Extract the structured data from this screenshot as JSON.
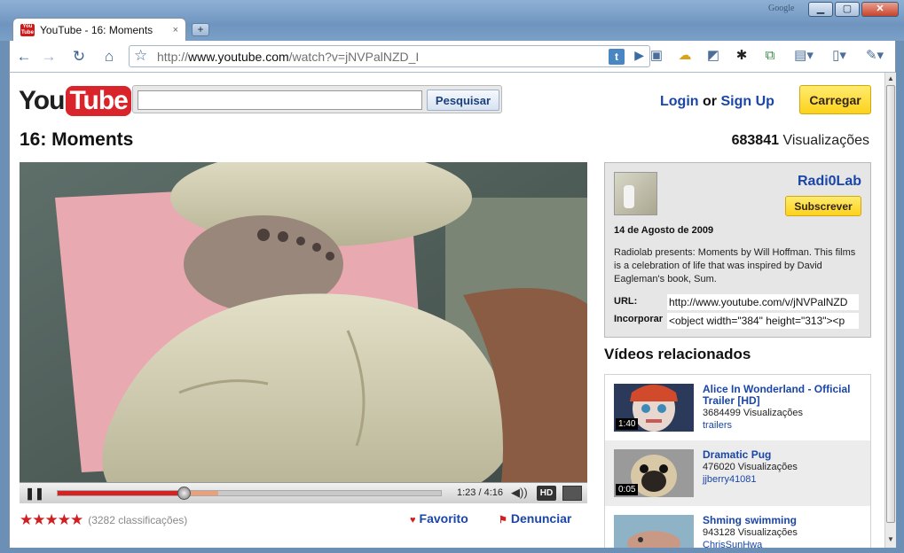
{
  "window": {
    "brand": "Google",
    "tab_title": "YouTube - 16: Moments",
    "tab_favicon": "You Tube",
    "tab_close": "×",
    "new_tab": "+",
    "minimize": "▁",
    "maximize": "▢",
    "close": "✕"
  },
  "toolbar": {
    "back": "←",
    "forward": "→",
    "reload": "↻",
    "home": "⌂",
    "star": "☆",
    "url_scheme": "http://",
    "url_host": "www.youtube.com",
    "url_path": "/watch?v=jNVPalNZD_I",
    "t_badge": "t",
    "go": "▶",
    "extensions": [
      "save-icon",
      "weather-icon",
      "notebook-icon",
      "gear-badge-icon",
      "puzzle-icon",
      "document-menu-icon",
      "page-menu-icon",
      "wrench-menu-icon"
    ],
    "extension_glyphs": [
      "▣",
      "☁",
      "◩",
      "✱",
      "⧉",
      "▤▾",
      "▯▾",
      "✎▾"
    ]
  },
  "header": {
    "logo_you": "You",
    "logo_tube": "Tube",
    "search_value": "",
    "search_button": "Pesquisar",
    "login": "Login",
    "or": "or",
    "signup": "Sign Up",
    "upload": "Carregar"
  },
  "video": {
    "title": "16: Moments",
    "views_count": "683841",
    "views_label": "Visualizações",
    "time": "1:23 / 4:16",
    "progress": 0.33,
    "buffered": 0.42,
    "pause": "❚❚",
    "volume": "◀))",
    "hd": "HD"
  },
  "actions": {
    "stars": "★★★★★",
    "rating_count": "(3282 classificações)",
    "favorite_icon": "♥",
    "favorite": "Favorito",
    "flag_icon": "⚑",
    "flag": "Denunciar"
  },
  "channel": {
    "name": "Radi0Lab",
    "subscribe": "Subscrever",
    "date": "14 de Agosto de 2009",
    "description": "Radiolab presents: Moments by Will Hoffman. This films is a celebration of life that was inspired by David Eagleman's book, Sum.",
    "url_label": "URL:",
    "url_value": "http://www.youtube.com/v/jNVPalNZD",
    "embed_label": "Incorporar",
    "embed_value": "<object width=\"384\" height=\"313\"><p"
  },
  "related": {
    "heading": "Vídeos relacionados",
    "items": [
      {
        "title": "Alice In Wonderland - Official Trailer [HD]",
        "views": "3684499 Visualizações",
        "user": "trailers",
        "duration": "1:40"
      },
      {
        "title": "Dramatic Pug",
        "views": "476020 Visualizações",
        "user": "jjberry41081",
        "duration": "0:05"
      },
      {
        "title": "Shming swimming",
        "views": "943128 Visualizações",
        "user": "ChrisSunHwa",
        "duration": ""
      }
    ]
  },
  "scrollbar": {
    "up": "▲",
    "down": "▼"
  }
}
